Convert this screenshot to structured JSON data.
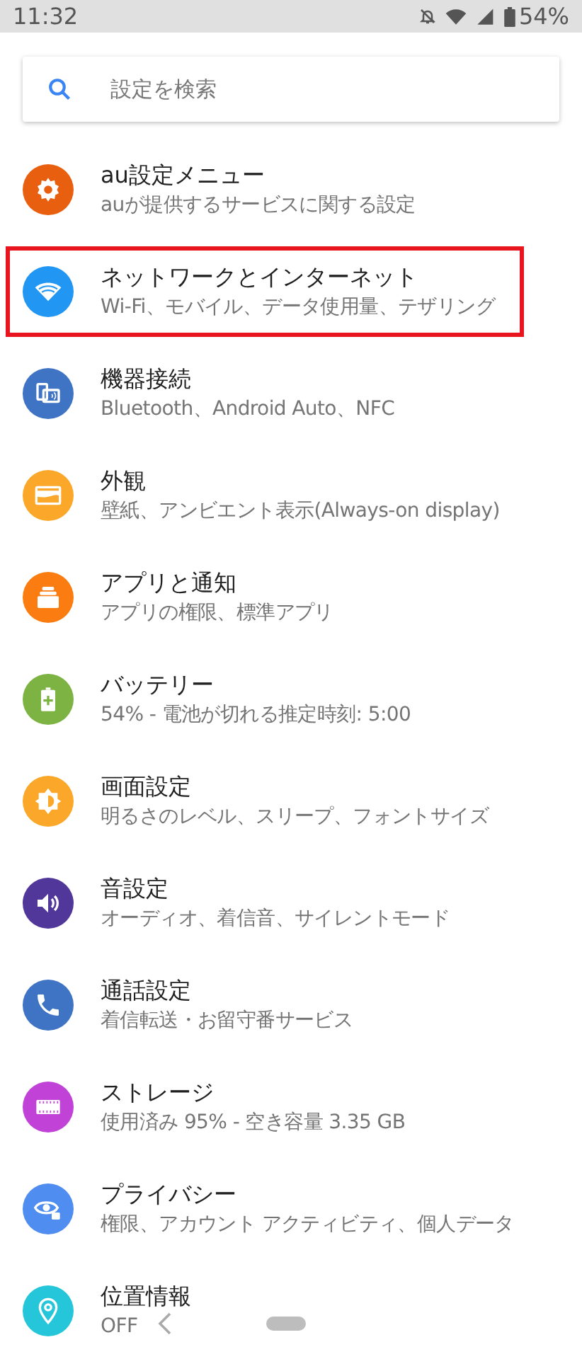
{
  "status_bar": {
    "time": "11:32",
    "battery": "54%"
  },
  "search": {
    "placeholder": "設定を検索"
  },
  "items": [
    {
      "kind": "gear",
      "color": "#e8600f",
      "title": "au設定メニュー",
      "subtitle": "auが提供するサービスに関する設定",
      "highlighted": false
    },
    {
      "kind": "wifi",
      "color": "#2196f3",
      "title": "ネットワークとインターネット",
      "subtitle": "Wi-Fi、モバイル、データ使用量、テザリング",
      "highlighted": true
    },
    {
      "kind": "devices",
      "color": "#3f74c4",
      "title": "機器接続",
      "subtitle": "Bluetooth、Android Auto、NFC",
      "highlighted": false
    },
    {
      "kind": "wallpaper",
      "color": "#fba72a",
      "title": "外観",
      "subtitle": "壁紙、アンビエント表示(Always-on display)",
      "highlighted": false
    },
    {
      "kind": "apps",
      "color": "#fb7d12",
      "title": "アプリと通知",
      "subtitle": "アプリの権限、標準アプリ",
      "highlighted": false
    },
    {
      "kind": "battery",
      "color": "#7cb342",
      "title": "バッテリー",
      "subtitle": "54% - 電池が切れる推定時刻: 5:00",
      "highlighted": false
    },
    {
      "kind": "display",
      "color": "#fba72a",
      "title": "画面設定",
      "subtitle": "明るさのレベル、スリープ、フォントサイズ",
      "highlighted": false
    },
    {
      "kind": "sound",
      "color": "#52379a",
      "title": "音設定",
      "subtitle": "オーディオ、着信音、サイレントモード",
      "highlighted": false
    },
    {
      "kind": "phone",
      "color": "#3f74c4",
      "title": "通話設定",
      "subtitle": "着信転送・お留守番サービス",
      "highlighted": false
    },
    {
      "kind": "storage",
      "color": "#c042d6",
      "title": "ストレージ",
      "subtitle": "使用済み 95% - 空き容量 3.35 GB",
      "highlighted": false
    },
    {
      "kind": "privacy",
      "color": "#4f8ef0",
      "title": "プライバシー",
      "subtitle": "権限、アカウント アクティビティ、個人データ",
      "highlighted": false
    },
    {
      "kind": "location",
      "color": "#26c6da",
      "title": "位置情報",
      "subtitle": "OFF",
      "highlighted": false
    }
  ]
}
